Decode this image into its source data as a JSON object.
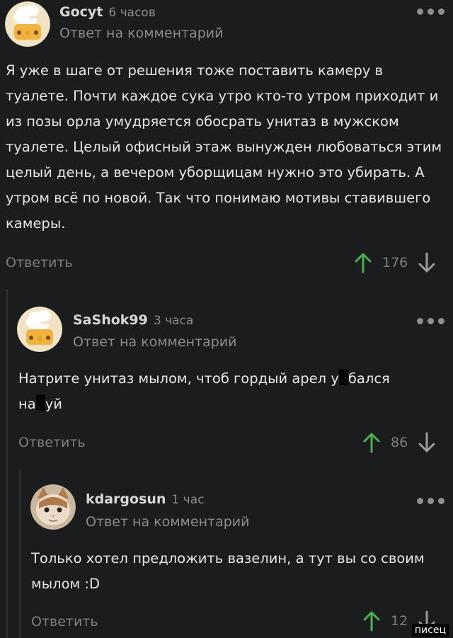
{
  "comments": [
    {
      "author": "Gocyt",
      "time": "6 часов",
      "reply_to": "Ответ на комментарий",
      "text": "Я уже в шаге от решения тоже поставить камеру в туалете. Почти каждое сука утро кто-то утром приходит и из позы орла умудряется обосрать унитаз в мужском туалете. Целый офисный этаж вынужден любоваться этим целый день, а вечером уборщицам нужно это убирать. А утром всё по новой. Так что понимаю мотивы ставившего камеры.",
      "reply_label": "Ответить",
      "score": "176",
      "avatar_icon": "chef-hat-avatar-icon"
    },
    {
      "author": "SaShok99",
      "time": "3 часа",
      "reply_to": "Ответ на комментарий",
      "text_part1": "Натрите унитаз мылом, чтоб гордый арел у",
      "text_part2": "бался",
      "text_part3": "на",
      "text_part4": "уй",
      "reply_label": "Ответить",
      "score": "86",
      "avatar_icon": "chef-hat-avatar-icon"
    },
    {
      "author": "kdargosun",
      "time": "1 час",
      "reply_to": "Ответ на комментарий",
      "text": "Только хотел предложить вазелин, а тут вы со своим мылом :D",
      "reply_label": "Ответить",
      "score": "12",
      "avatar_icon": "cat-avatar-icon"
    }
  ],
  "colors": {
    "background": "#1b1c1e",
    "upvote": "#4caf50",
    "muted": "#7d7e81"
  },
  "watermark": "писец"
}
